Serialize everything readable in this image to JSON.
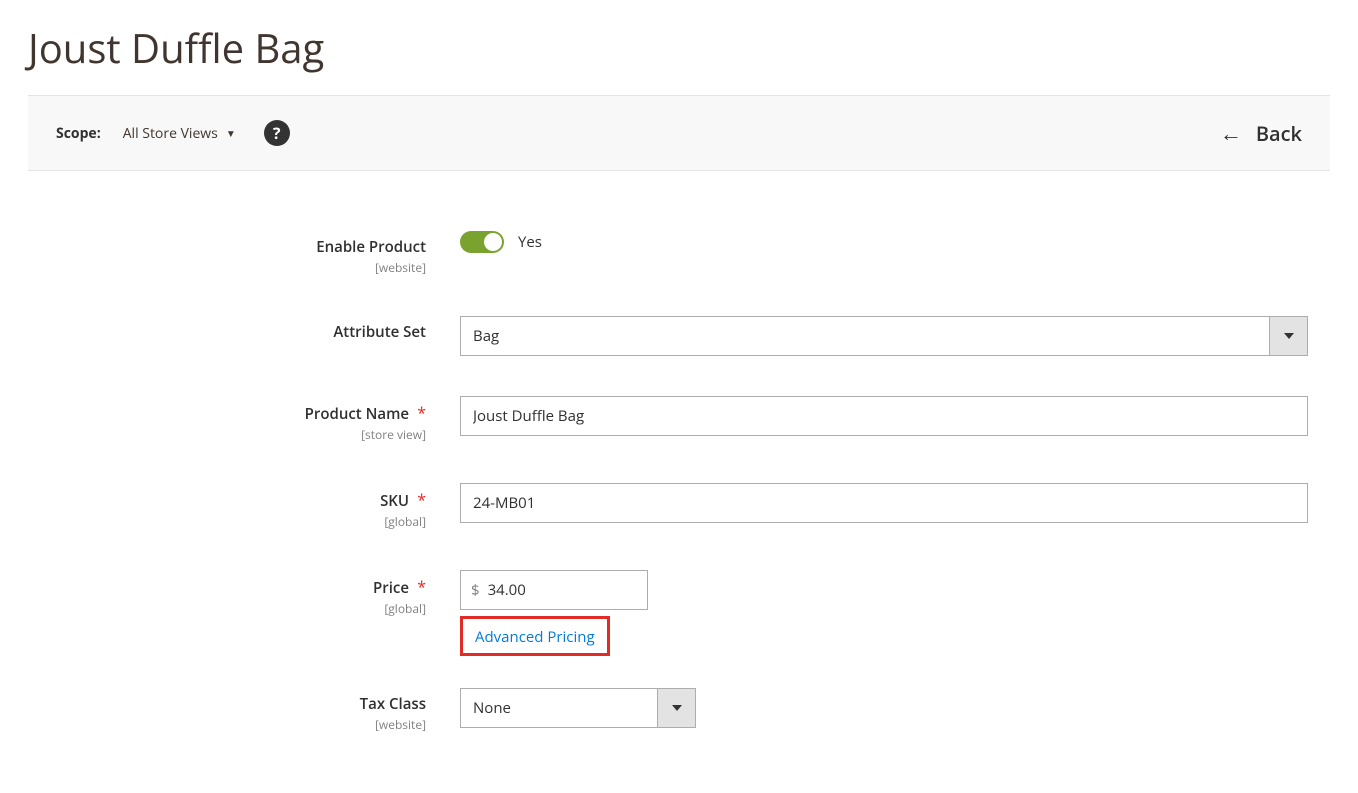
{
  "page": {
    "title": "Joust Duffle Bag"
  },
  "actions": {
    "scope_label": "Scope:",
    "scope_value": "All Store Views",
    "back_label": "Back"
  },
  "fields": {
    "enable_product": {
      "label": "Enable Product",
      "scope": "[website]",
      "value_text": "Yes",
      "on": true
    },
    "attribute_set": {
      "label": "Attribute Set",
      "value": "Bag"
    },
    "product_name": {
      "label": "Product Name",
      "scope": "[store view]",
      "value": "Joust Duffle Bag",
      "required": true
    },
    "sku": {
      "label": "SKU",
      "scope": "[global]",
      "value": "24-MB01",
      "required": true
    },
    "price": {
      "label": "Price",
      "scope": "[global]",
      "currency": "$",
      "value": "34.00",
      "required": true,
      "advanced_link": "Advanced Pricing"
    },
    "tax_class": {
      "label": "Tax Class",
      "scope": "[website]",
      "value": "None"
    }
  }
}
